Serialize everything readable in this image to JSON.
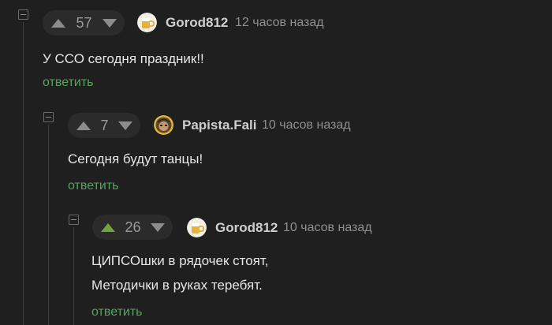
{
  "colors": {
    "accent_green": "#71a63f",
    "reply_green": "#57a55a",
    "background": "#1f1f1f"
  },
  "comments": [
    {
      "rating": "57",
      "author": "Gorod812",
      "avatar_icon": "beer-mug-icon",
      "time": "12 часов назад",
      "lines": [
        "У ССО сегодня праздник!!"
      ],
      "reply_label": "ответить"
    },
    {
      "rating": "7",
      "author": "Papista.Fali",
      "avatar_icon": "character-portrait-icon",
      "time": "10 часов назад",
      "lines": [
        "Сегодня будут танцы!"
      ],
      "reply_label": "ответить"
    },
    {
      "rating": "26",
      "upvoted": true,
      "author": "Gorod812",
      "avatar_icon": "beer-mug-icon",
      "time": "10 часов назад",
      "lines": [
        "ЦИПСОшки в рядочек стоят,",
        "Методички в руках теребят."
      ],
      "reply_label": "ответить"
    }
  ]
}
